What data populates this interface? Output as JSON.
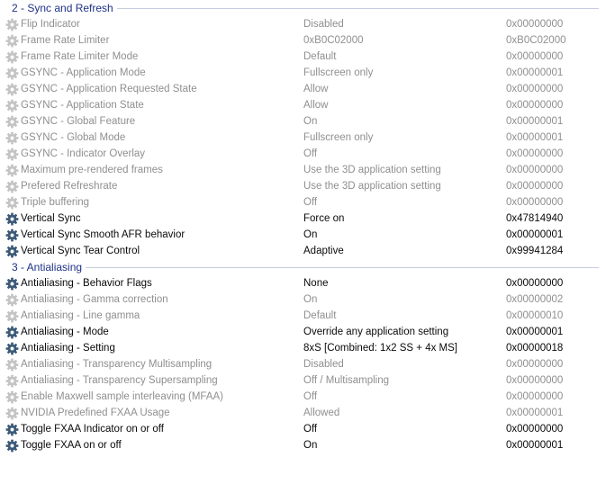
{
  "groups": [
    {
      "title": "2 - Sync and Refresh",
      "rows": [
        {
          "name": "Flip Indicator",
          "value": "Disabled",
          "hex": "0x00000000",
          "active": false,
          "icon": "gear-icon"
        },
        {
          "name": "Frame Rate Limiter",
          "value": "0xB0C02000",
          "hex": "0xB0C02000",
          "active": false,
          "icon": "gear-icon"
        },
        {
          "name": "Frame Rate Limiter Mode",
          "value": "Default",
          "hex": "0x00000000",
          "active": false,
          "icon": "gear-icon"
        },
        {
          "name": "GSYNC - Application Mode",
          "value": "Fullscreen only",
          "hex": "0x00000001",
          "active": false,
          "icon": "gear-icon"
        },
        {
          "name": "GSYNC - Application Requested State",
          "value": "Allow",
          "hex": "0x00000000",
          "active": false,
          "icon": "gear-icon"
        },
        {
          "name": "GSYNC - Application State",
          "value": "Allow",
          "hex": "0x00000000",
          "active": false,
          "icon": "gear-icon"
        },
        {
          "name": "GSYNC - Global Feature",
          "value": "On",
          "hex": "0x00000001",
          "active": false,
          "icon": "gear-icon"
        },
        {
          "name": "GSYNC - Global Mode",
          "value": "Fullscreen only",
          "hex": "0x00000001",
          "active": false,
          "icon": "gear-icon"
        },
        {
          "name": "GSYNC - Indicator Overlay",
          "value": "Off",
          "hex": "0x00000000",
          "active": false,
          "icon": "gear-icon"
        },
        {
          "name": "Maximum pre-rendered frames",
          "value": "Use the 3D application setting",
          "hex": "0x00000000",
          "active": false,
          "icon": "gear-icon"
        },
        {
          "name": "Prefered Refreshrate",
          "value": "Use the 3D application setting",
          "hex": "0x00000000",
          "active": false,
          "icon": "gear-icon"
        },
        {
          "name": "Triple buffering",
          "value": "Off",
          "hex": "0x00000000",
          "active": false,
          "icon": "gear-icon"
        },
        {
          "name": "Vertical Sync",
          "value": "Force on",
          "hex": "0x47814940",
          "active": true,
          "icon": "gear-icon"
        },
        {
          "name": "Vertical Sync Smooth AFR behavior",
          "value": "On",
          "hex": "0x00000001",
          "active": true,
          "icon": "gear-icon"
        },
        {
          "name": "Vertical Sync Tear Control",
          "value": "Adaptive",
          "hex": "0x99941284",
          "active": true,
          "icon": "gear-icon"
        }
      ]
    },
    {
      "title": "3 - Antialiasing",
      "rows": [
        {
          "name": "Antialiasing - Behavior Flags",
          "value": "None",
          "hex": "0x00000000",
          "active": true,
          "icon": "gear-icon"
        },
        {
          "name": "Antialiasing - Gamma correction",
          "value": "On",
          "hex": "0x00000002",
          "active": false,
          "icon": "gear-icon"
        },
        {
          "name": "Antialiasing - Line gamma",
          "value": "Default",
          "hex": "0x00000010",
          "active": false,
          "icon": "gear-icon"
        },
        {
          "name": "Antialiasing - Mode",
          "value": "Override any application setting",
          "hex": "0x00000001",
          "active": true,
          "icon": "gear-icon"
        },
        {
          "name": "Antialiasing - Setting",
          "value": "8xS [Combined: 1x2 SS + 4x MS]",
          "hex": "0x00000018",
          "active": true,
          "icon": "gear-icon"
        },
        {
          "name": "Antialiasing - Transparency Multisampling",
          "value": "Disabled",
          "hex": "0x00000000",
          "active": false,
          "icon": "gear-icon"
        },
        {
          "name": "Antialiasing - Transparency Supersampling",
          "value": "Off / Multisampling",
          "hex": "0x00000000",
          "active": false,
          "icon": "gear-icon"
        },
        {
          "name": "Enable Maxwell sample interleaving (MFAA)",
          "value": "Off",
          "hex": "0x00000000",
          "active": false,
          "icon": "gear-icon"
        },
        {
          "name": "NVIDIA Predefined FXAA Usage",
          "value": "Allowed",
          "hex": "0x00000001",
          "active": false,
          "icon": "gear-icon"
        },
        {
          "name": "Toggle FXAA Indicator on or off",
          "value": "Off",
          "hex": "0x00000000",
          "active": true,
          "icon": "gear-icon"
        },
        {
          "name": "Toggle FXAA on or off",
          "value": "On",
          "hex": "0x00000001",
          "active": true,
          "icon": "gear-icon"
        }
      ]
    }
  ],
  "colors": {
    "group_title": "#1e3287",
    "active_text": "#0a0a0a",
    "inactive_text": "#8f8f8f",
    "active_gear": "#3c5a78",
    "inactive_gear": "#c4c4c4"
  }
}
